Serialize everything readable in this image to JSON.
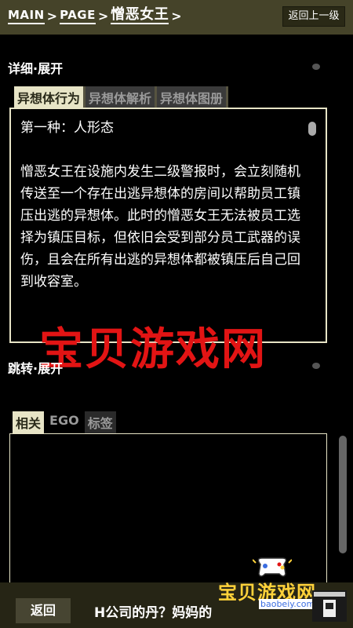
{
  "header": {
    "crumbs": [
      "MAIN",
      "PAGE",
      "憎恶女王"
    ],
    "separator": ">",
    "back_top_label": "返回上一级"
  },
  "detail": {
    "title": "详细·展开",
    "tabs": [
      {
        "label": "异想体行为",
        "active": true
      },
      {
        "label": "异想体解析",
        "active": false
      },
      {
        "label": "异想体图册",
        "active": false
      }
    ],
    "subhead": "第一种：人形态",
    "body": "憎恶女王在设施内发生二级警报时，会立刻随机传送至一个存在出逃异想体的房间以帮助员工镇压出逃的异想体。此时的憎恶女王无法被员工选择为镇压目标，但依旧会受到部分员工武器的误伤，且会在所有出逃的异想体都被镇压后自己回到收容室。"
  },
  "watermark": "宝贝游戏网",
  "jump": {
    "title": "跳转·展开",
    "tabs": [
      {
        "label": "相关",
        "active": true
      },
      {
        "label": "EGO",
        "active": false
      },
      {
        "label": "标签",
        "active": false
      }
    ]
  },
  "footer": {
    "back_label": "返回",
    "text": "H公司的丹？妈妈的"
  },
  "logo": {
    "text": "宝贝游戏网",
    "url": "baobeiy.com"
  },
  "colors": {
    "header_bg": "#454329",
    "accent_cream": "#e7e4c6",
    "watermark_red": "#e21414",
    "logo_yellow": "#ffd23a"
  }
}
